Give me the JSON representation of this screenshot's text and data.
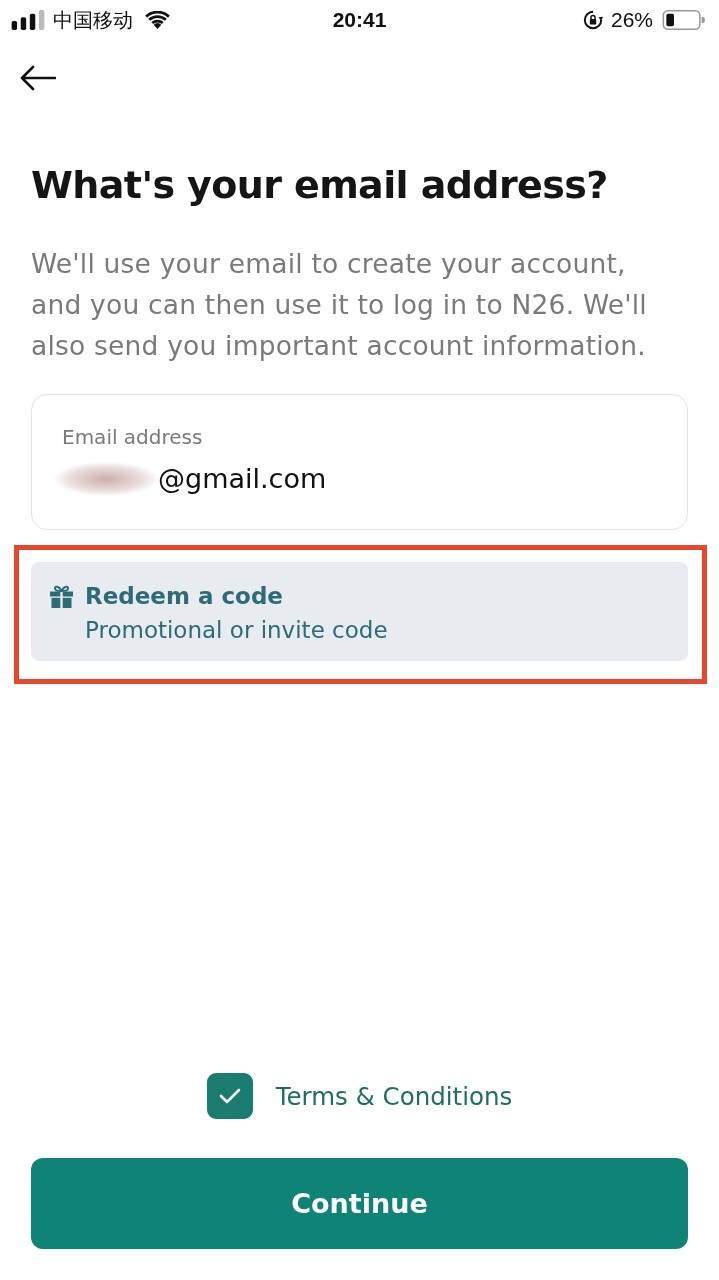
{
  "status_bar": {
    "carrier": "中国移动",
    "time": "20:41",
    "battery_percent": "26%"
  },
  "title": "What's your email address?",
  "description": "We'll use your email to create your account, and you can then use it to log in to N26. We'll also send you important account information.",
  "email_field": {
    "label": "Email address",
    "value": "@gmail.com",
    "blurred_prefix": true
  },
  "redeem": {
    "title": "Redeem a code",
    "subtitle": "Promotional or invite code",
    "highlighted": true
  },
  "terms": {
    "label": "Terms & Conditions",
    "checked": true
  },
  "continue_button": {
    "label": "Continue"
  }
}
